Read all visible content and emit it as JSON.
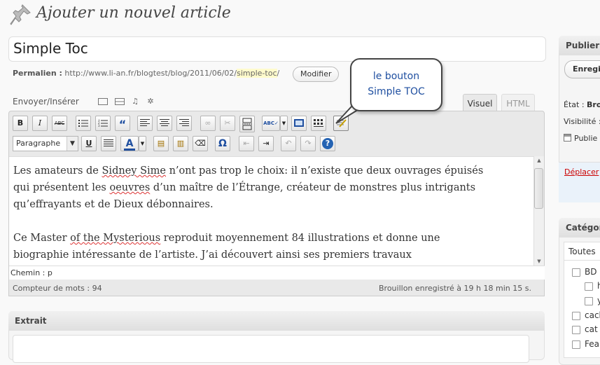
{
  "page": {
    "title": "Ajouter un nouvel article"
  },
  "post": {
    "title": "Simple Toc",
    "permalink_label": "Permalien :",
    "permalink_base": "http://www.li-an.fr/blogtest/blog/2011/06/02/",
    "permalink_slug": "simple-toc",
    "permalink_end": "/",
    "modify_label": "Modifier"
  },
  "upload": {
    "label": "Envoyer/Insérer"
  },
  "tabs": {
    "visual": "Visuel",
    "html": "HTML"
  },
  "toolbar": {
    "format_value": "Paragraphe",
    "bold": "B",
    "italic": "I",
    "strike": "ABC",
    "quote": "“",
    "char": "Ω",
    "help": "?"
  },
  "content": {
    "para1": [
      "Les amateurs de ",
      "Sidney Sime",
      " n’ont pas trop le choix: il n’existe que deux ouvrages épuisés",
      "qui présentent les ",
      "oeuvres",
      " d’un maître de l’Étrange, créateur de monstres plus intrigants",
      "qu’effrayants et de Dieux débonnaires."
    ],
    "para2": [
      "Ce Master ",
      "of the Mysterious",
      " reproduit moyennement 84 illustrations et donne une",
      "biographie intéressante de l’artiste. J’ai découvert ainsi ses premiers travaux"
    ]
  },
  "editor_footer": {
    "path": "Chemin : p",
    "word_count": "Compteur de mots : 94",
    "draft_status": "Brouillon enregistré à 19 h 18 min 15 s."
  },
  "excerpt": {
    "title": "Extrait"
  },
  "callout": {
    "line1": "le bouton",
    "line2": "Simple TOC"
  },
  "sidebar": {
    "publish": {
      "title": "Publier",
      "save_draft": "Enregi",
      "state_label": "État :",
      "state_value": "Bro",
      "visibility": "Visibilité :",
      "publish_date": "Publie",
      "delete": "Déplacer"
    },
    "categories": {
      "title": "Catégories",
      "tab_all": "Toutes",
      "items": [
        "BD",
        "h",
        "y",
        "cach",
        "cat",
        "Fea"
      ]
    }
  }
}
